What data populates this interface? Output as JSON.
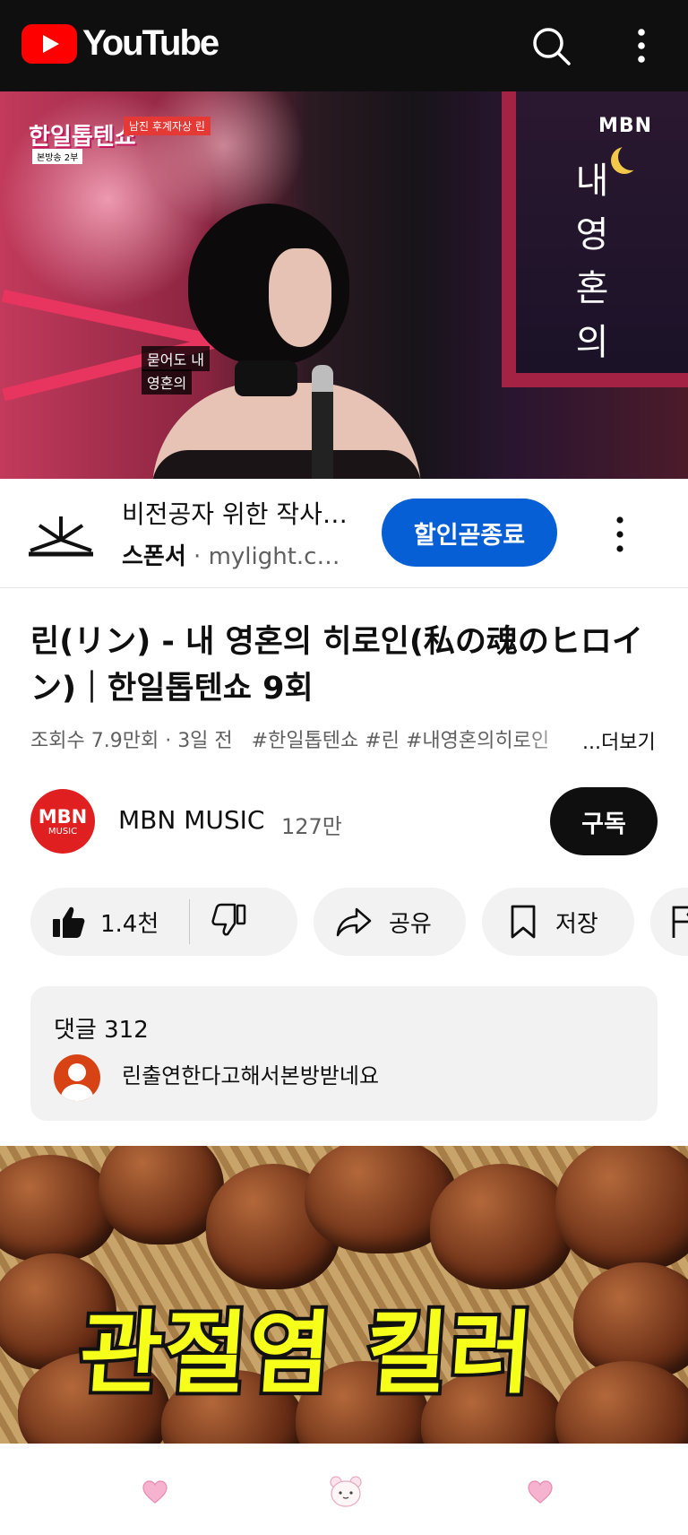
{
  "topbar": {
    "logo_text": "YouTube",
    "search_icon": "search-icon",
    "more_icon": "more-vert-icon"
  },
  "player": {
    "show_logo": "한일톱텐쇼",
    "show_tag": "남진 후계자상 린",
    "show_sub": "본방송 2부",
    "broadcaster": "MBN",
    "vertical_title": [
      "내",
      "영",
      "혼",
      "의"
    ],
    "caption_lines": [
      "묻어도 내",
      "영혼의"
    ]
  },
  "ad": {
    "title": "비전공자 위한 작사…",
    "sponsor_label": "스폰서",
    "sponsor_separator": "·",
    "url": "mylight.c…",
    "cta_label": "할인곧종료",
    "more_icon": "more-vert-icon"
  },
  "video": {
    "title": "린(リン) - 내 영혼의 히로인(私の魂のヒロイン)｜한일톱텐쇼 9회",
    "views": "조회수 7.9만회",
    "age": "3일 전",
    "separator": "·",
    "tags": "#한일톱텐쇼 #린 #내영혼의히로인",
    "more_label": "...더보기"
  },
  "channel": {
    "avatar_line1": "MBN",
    "avatar_line2": "MUSIC",
    "name": "MBN MUSIC",
    "subscribers": "127만",
    "subscribe_label": "구독"
  },
  "actions": {
    "like_count": "1.4천",
    "share_label": "공유",
    "save_label": "저장"
  },
  "comments": {
    "count_label": "댓글 312",
    "top_comment": "린출연한다고해서본방받네요"
  },
  "next_video": {
    "thumbnail_text": "관절염 킬러"
  },
  "colors": {
    "brand_red": "#ff0000",
    "cta_blue": "#065fd4",
    "subscribe_black": "#0f0f0f",
    "thumb_text_yellow": "#f5ff1a",
    "nav_heart_pink": "#f6b3cf"
  }
}
